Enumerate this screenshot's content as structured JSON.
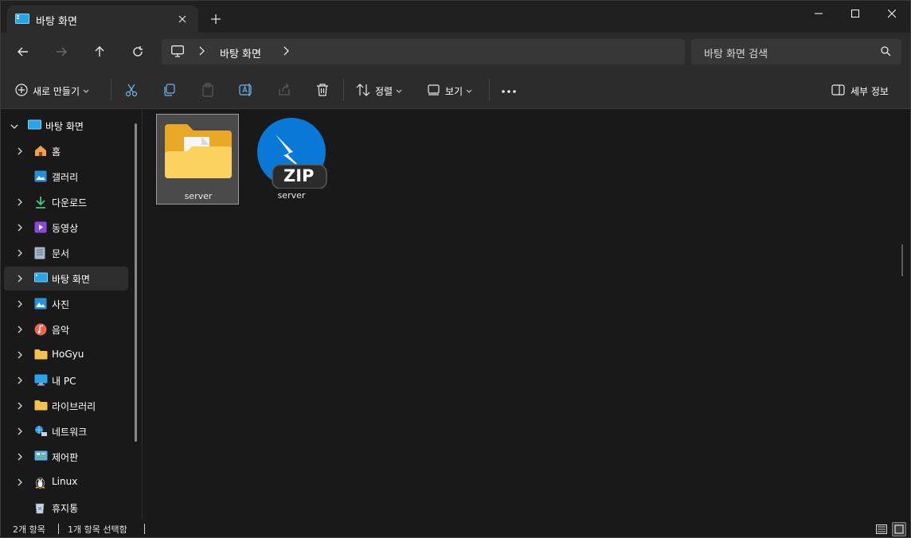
{
  "tab": {
    "title": "바탕 화면",
    "icon": "desktop-icon"
  },
  "window_controls": {
    "minimize": "minimize-icon",
    "maximize": "maximize-icon",
    "close": "close-icon"
  },
  "address": {
    "crumbs": [
      "바탕 화면"
    ]
  },
  "search": {
    "placeholder": "바탕 화면 검색"
  },
  "toolbar": {
    "new_label": "새로 만들기",
    "sort_label": "정렬",
    "view_label": "보기",
    "details_label": "세부 정보"
  },
  "sidebar": {
    "root": {
      "label": "바탕 화면",
      "icon": "desktop-icon"
    },
    "items": [
      {
        "label": "홈",
        "icon": "home-icon",
        "chevron": true
      },
      {
        "label": "갤러리",
        "icon": "gallery-icon",
        "chevron": false
      },
      {
        "label": "다운로드",
        "icon": "download-icon",
        "chevron": true
      },
      {
        "label": "동영상",
        "icon": "video-icon",
        "chevron": true
      },
      {
        "label": "문서",
        "icon": "document-icon",
        "chevron": true
      },
      {
        "label": "바탕 화면",
        "icon": "desktop-icon",
        "chevron": true,
        "selected": true
      },
      {
        "label": "사진",
        "icon": "pictures-icon",
        "chevron": true
      },
      {
        "label": "음악",
        "icon": "music-icon",
        "chevron": true
      },
      {
        "label": "HoGyu",
        "icon": "folder-icon",
        "chevron": true
      },
      {
        "label": "내 PC",
        "icon": "pc-icon",
        "chevron": true
      },
      {
        "label": "라이브러리",
        "icon": "folder-icon",
        "chevron": true
      },
      {
        "label": "네트워크",
        "icon": "network-icon",
        "chevron": true
      },
      {
        "label": "제어판",
        "icon": "control-panel-icon",
        "chevron": true
      },
      {
        "label": "Linux",
        "icon": "linux-icon",
        "chevron": true
      },
      {
        "label": "휴지통",
        "icon": "recycle-bin-icon",
        "chevron": false
      }
    ]
  },
  "files": [
    {
      "name": "server",
      "type": "folder",
      "selected": true
    },
    {
      "name": "server",
      "type": "zip",
      "badge": "ZIP"
    }
  ],
  "status": {
    "count": "2개 항목",
    "selected": "1개 항목 선택함"
  },
  "colors": {
    "accent": "#0078d4",
    "folder": "#f4c24d",
    "background": "#191919"
  }
}
